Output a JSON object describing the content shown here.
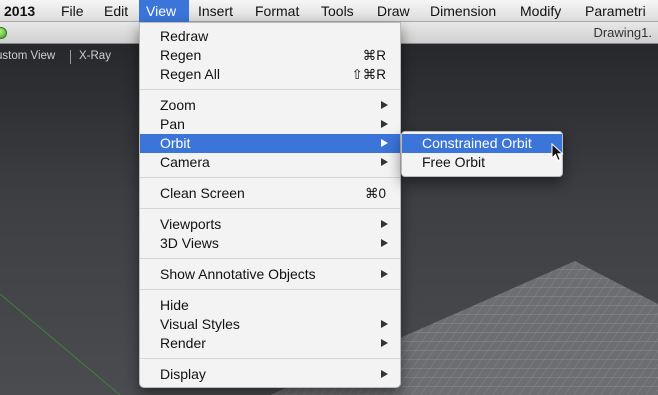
{
  "menubar": {
    "app_label": "2013",
    "items": [
      "File",
      "Edit",
      "View",
      "Insert",
      "Format",
      "Tools",
      "Draw",
      "Dimension",
      "Modify",
      "Parametri"
    ]
  },
  "window": {
    "title": "Drawing1."
  },
  "viewport": {
    "view_label": "ustom View",
    "mode_label": "X-Ray"
  },
  "view_menu": {
    "redraw": {
      "label": "Redraw"
    },
    "regen": {
      "label": "Regen",
      "shortcut": "⌘R"
    },
    "regen_all": {
      "label": "Regen All",
      "shortcut": "⇧⌘R"
    },
    "zoom": {
      "label": "Zoom"
    },
    "pan": {
      "label": "Pan"
    },
    "orbit": {
      "label": "Orbit"
    },
    "camera": {
      "label": "Camera"
    },
    "clean_screen": {
      "label": "Clean Screen",
      "shortcut": "⌘0"
    },
    "viewports": {
      "label": "Viewports"
    },
    "views_3d": {
      "label": "3D Views"
    },
    "show_annotative": {
      "label": "Show Annotative Objects"
    },
    "hide": {
      "label": "Hide"
    },
    "visual_styles": {
      "label": "Visual Styles"
    },
    "render": {
      "label": "Render"
    },
    "display": {
      "label": "Display"
    }
  },
  "orbit_submenu": {
    "constrained": "Constrained Orbit",
    "free": "Free Orbit"
  },
  "colors": {
    "selection": "#3b75d9",
    "menu_bg": "#f3f3f3",
    "viewport_bg": "#3d3f43"
  }
}
